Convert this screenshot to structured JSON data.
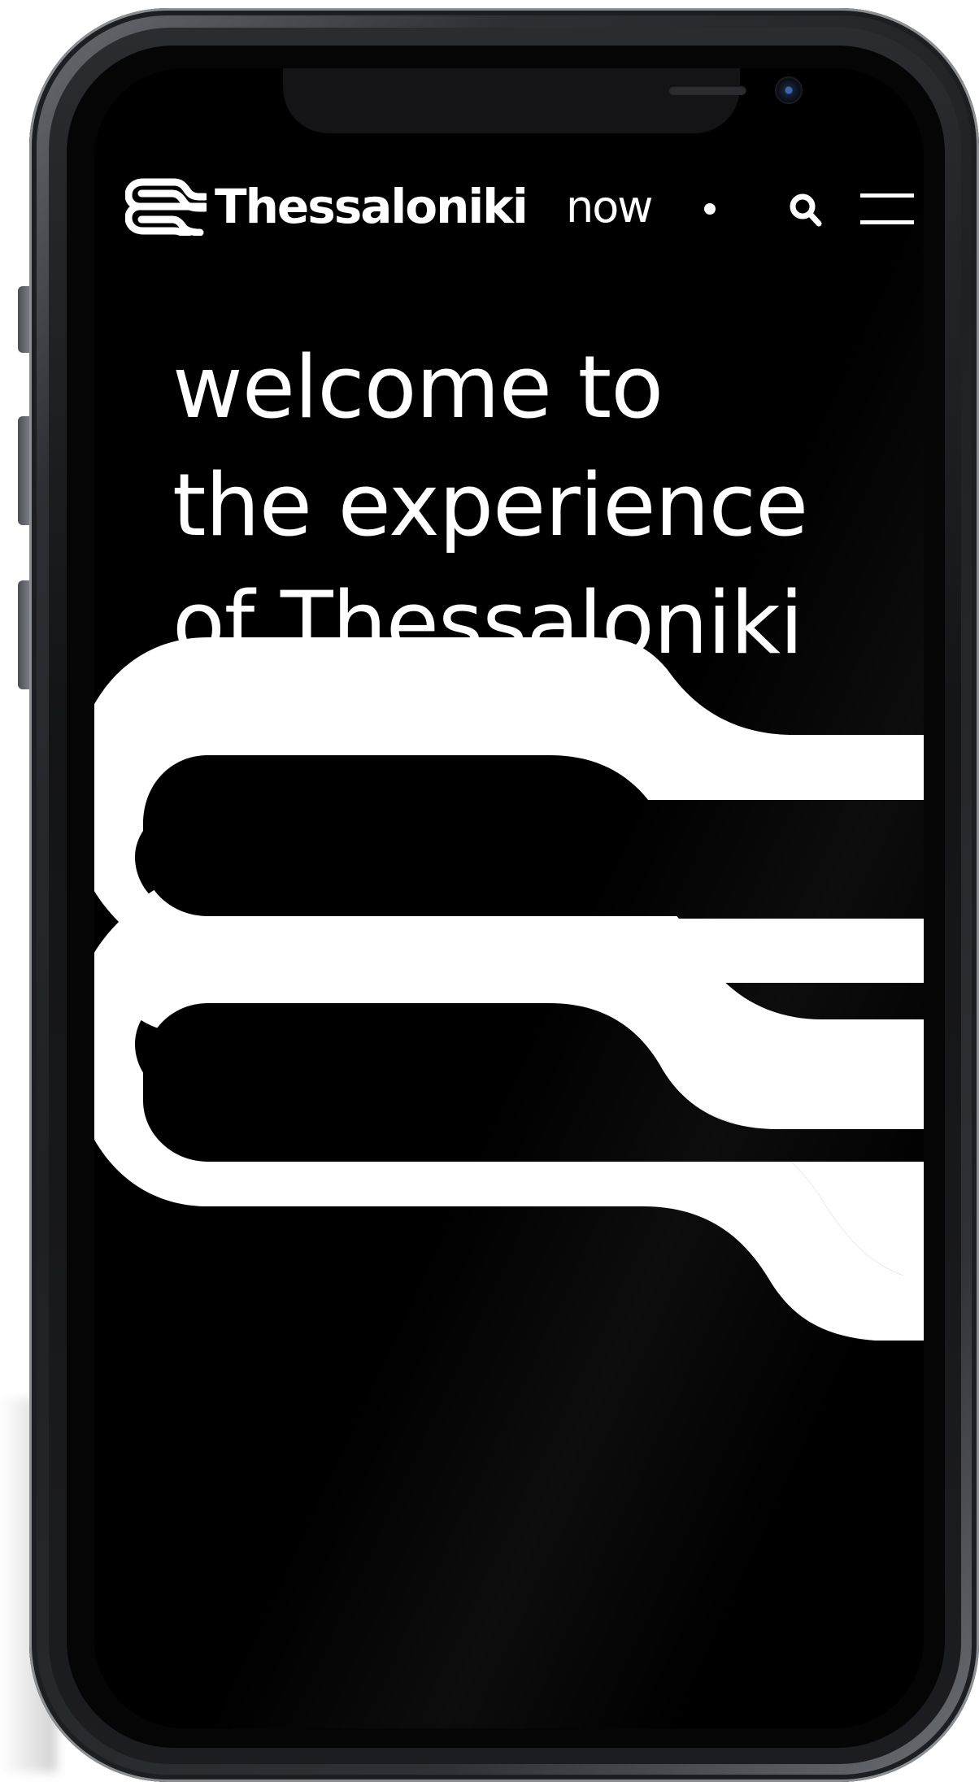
{
  "brand": {
    "name_bold": "Thessaloniki",
    "name_light": "now"
  },
  "header": {
    "search_icon": "search-icon",
    "menu_icon": "hamburger-menu-icon"
  },
  "hero": {
    "lines": [
      "welcome to",
      "the experience",
      "of Thessaloniki"
    ]
  },
  "colors": {
    "background": "#000000",
    "foreground": "#ffffff",
    "device_frame": "#1e2023"
  }
}
